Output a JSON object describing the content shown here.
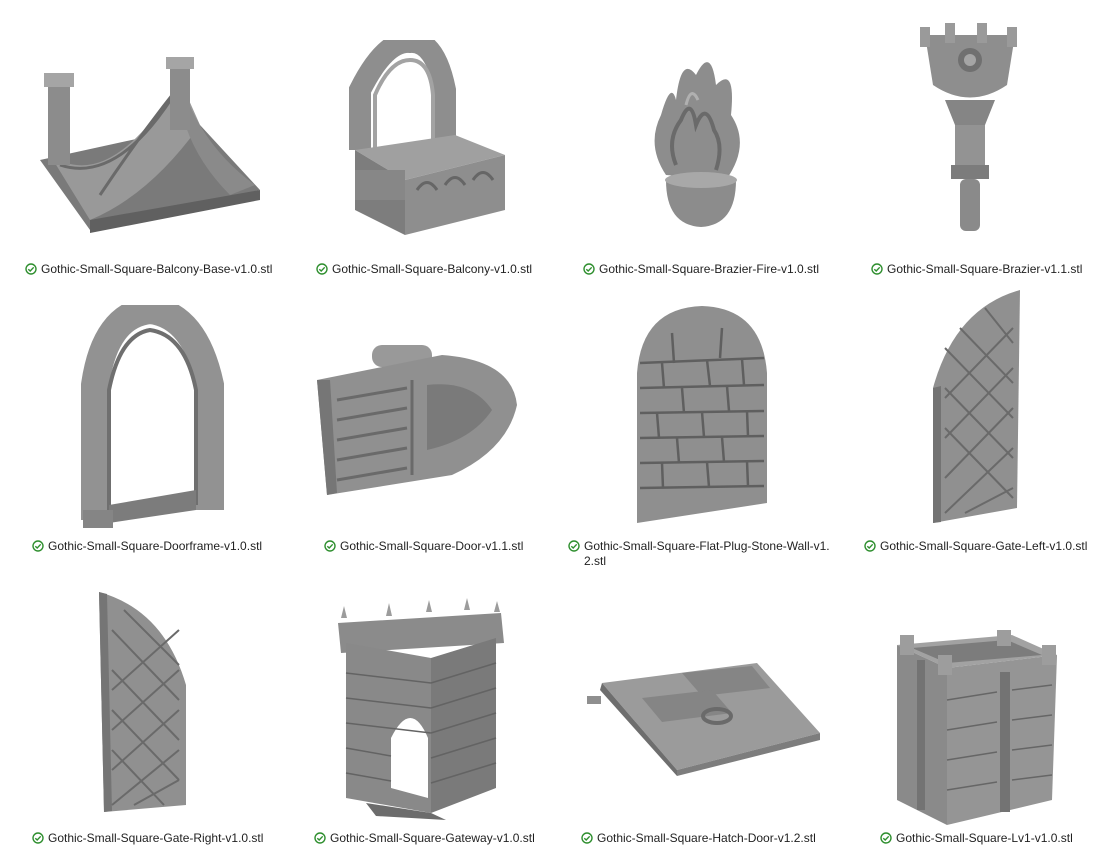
{
  "files": [
    {
      "name": "Gothic-Small-Square-Balcony-Base-v1.0.stl",
      "status_icon": "synced-check-icon"
    },
    {
      "name": "Gothic-Small-Square-Balcony-v1.0.stl",
      "status_icon": "synced-check-icon"
    },
    {
      "name": "Gothic-Small-Square-Brazier-Fire-v1.0.stl",
      "status_icon": "synced-check-icon"
    },
    {
      "name": "Gothic-Small-Square-Brazier-v1.1.stl",
      "status_icon": "synced-check-icon"
    },
    {
      "name": "Gothic-Small-Square-Doorframe-v1.0.stl",
      "status_icon": "synced-check-icon"
    },
    {
      "name": "Gothic-Small-Square-Door-v1.1.stl",
      "status_icon": "synced-check-icon"
    },
    {
      "name": "Gothic-Small-Square-Flat-Plug-Stone-Wall-v1.2.stl",
      "status_icon": "synced-check-icon"
    },
    {
      "name": "Gothic-Small-Square-Gate-Left-v1.0.stl",
      "status_icon": "synced-check-icon"
    },
    {
      "name": "Gothic-Small-Square-Gate-Right-v1.0.stl",
      "status_icon": "synced-check-icon"
    },
    {
      "name": "Gothic-Small-Square-Gateway-v1.0.stl",
      "status_icon": "synced-check-icon"
    },
    {
      "name": "Gothic-Small-Square-Hatch-Door-v1.2.stl",
      "status_icon": "synced-check-icon"
    },
    {
      "name": "Gothic-Small-Square-Lv1-v1.0.stl",
      "status_icon": "synced-check-icon"
    }
  ],
  "colors": {
    "model_fill": "#8f8f8f",
    "model_shade": "#6d6d6d",
    "model_light": "#b4b4b4",
    "sync_green": "#2f8f2f"
  }
}
